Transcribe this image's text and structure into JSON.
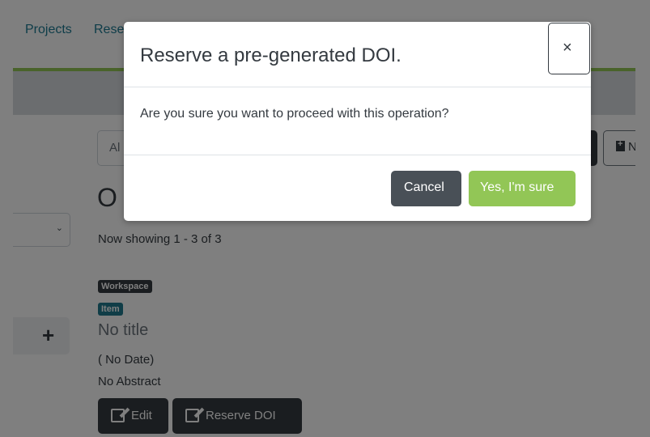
{
  "nav": {
    "projects_label": "Projects",
    "research_label": "Rese",
    "accent_color": "#92c656"
  },
  "search": {
    "value_fragment": "Al"
  },
  "new_button_label": "N",
  "results": {
    "title_fragment": "O",
    "showing": "Now showing 1 - 3 of 3"
  },
  "item": {
    "badge_workspace": "Workspace",
    "badge_item": "Item",
    "title": "No title",
    "date": "( No Date)",
    "abstract": "No Abstract",
    "edit_label": "Edit",
    "reserve_doi_label": "Reserve DOI"
  },
  "sidebar": {
    "add_label": "+"
  },
  "modal": {
    "title": "Reserve a pre-generated DOI.",
    "close_label": "×",
    "body": "Are you sure you want to proceed with this operation?",
    "cancel_label": "Cancel",
    "confirm_label": "Yes, I'm sure",
    "confirm_color": "#92c656",
    "cancel_color": "#495057"
  },
  "icons": {
    "select_chevron": "chevron-down-icon",
    "new_item": "file-plus-icon",
    "edit": "edit-icon"
  }
}
